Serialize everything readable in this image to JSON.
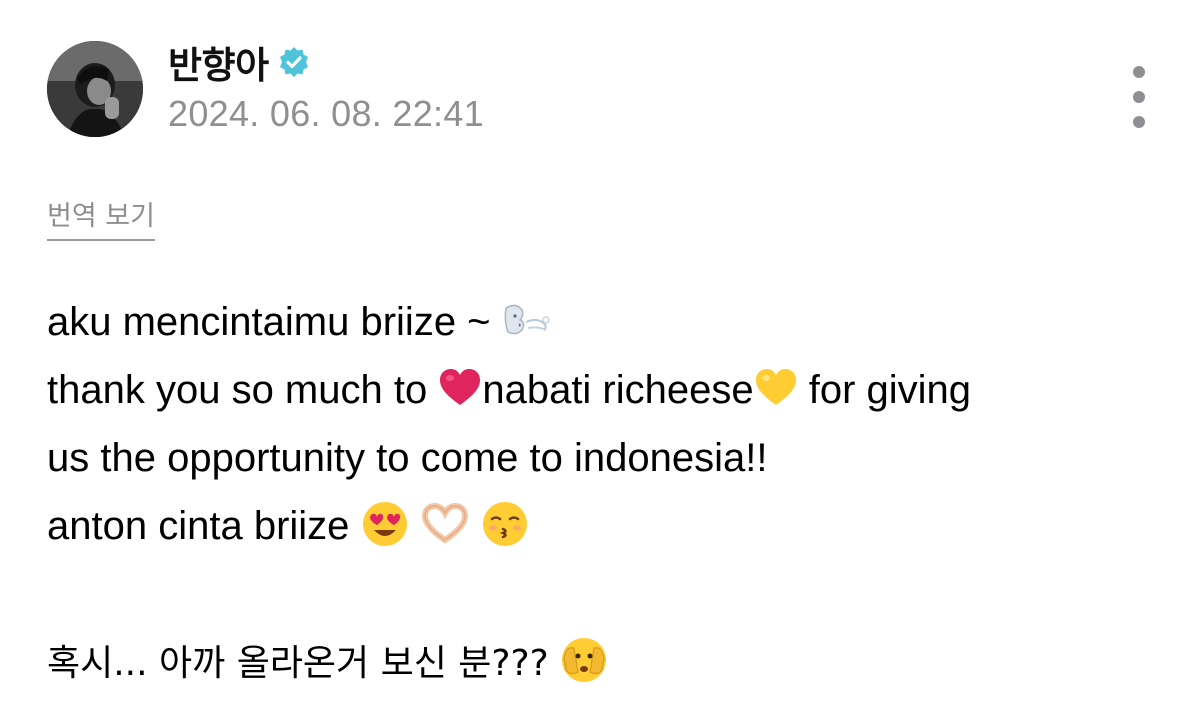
{
  "header": {
    "username": "반향아",
    "timestamp": "2024. 06. 08. 22:41",
    "verified_badge": "verified-badge-icon",
    "more_menu": "more-vertical-icon"
  },
  "translate_link": "번역 보기",
  "post": {
    "line1": {
      "text": "aku mencintaimu briize ~ ",
      "emoji": [
        "wind-face-emoji"
      ]
    },
    "line2": {
      "part1": "thank you so much to ",
      "part2": "nabati richeese",
      "part3": " for giving",
      "emoji": [
        "red-heart-emoji",
        "yellow-heart-emoji"
      ]
    },
    "line3": {
      "text": "us the opportunity to come to indonesia!!"
    },
    "line4": {
      "text": "anton cinta briize ",
      "emoji": [
        "heart-eyes-emoji",
        "heart-hands-emoji",
        "kissing-closed-eyes-emoji"
      ]
    },
    "line6": {
      "text": "혹시... 아까 올라온거 보신 분??? ",
      "emoji": [
        "face-peeking-eye-emoji"
      ]
    }
  },
  "colors": {
    "secondary_text": "#8e8e93",
    "verified_badge": "#4fc3d9",
    "heart_red": "#e0245e",
    "heart_yellow": "#ffcc33"
  }
}
